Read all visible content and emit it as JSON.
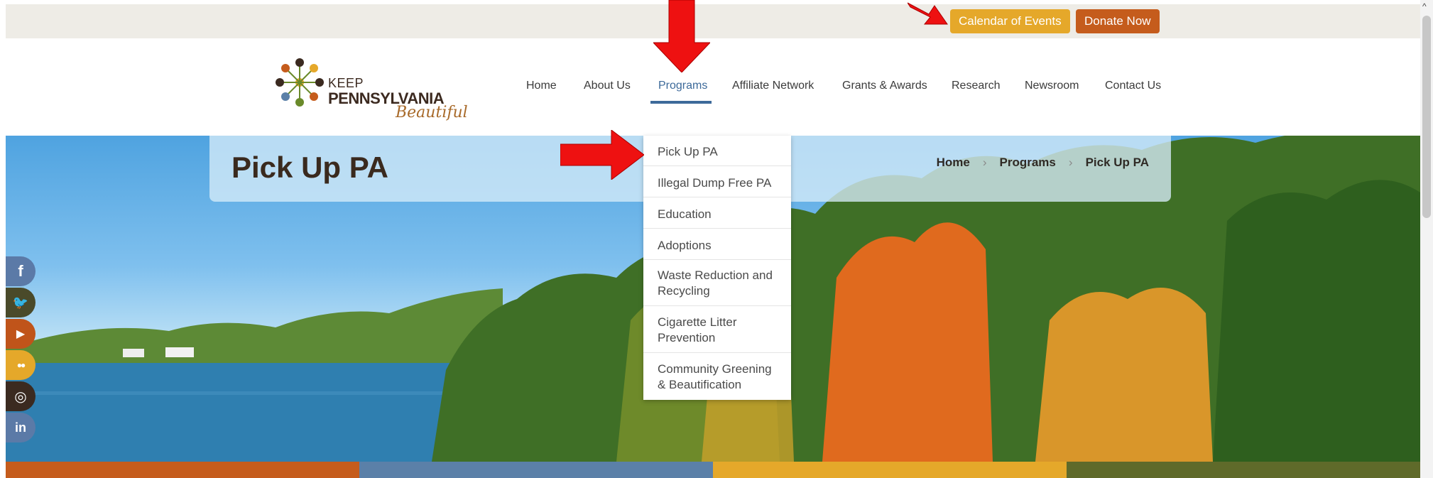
{
  "topbar": {
    "calendar_label": "Calendar of Events",
    "donate_label": "Donate Now"
  },
  "logo": {
    "line1": "KEEP",
    "line2": "PENNSYLVANIA",
    "line3": "Beautiful"
  },
  "nav": {
    "items": [
      "Home",
      "About Us",
      "Programs",
      "Affiliate Network",
      "Grants & Awards",
      "Research",
      "Newsroom",
      "Contact Us"
    ],
    "active": "Programs"
  },
  "page": {
    "title": "Pick Up PA",
    "breadcrumb": [
      "Home",
      "Programs",
      "Pick Up PA"
    ],
    "breadcrumb_separator": "›"
  },
  "dropdown": {
    "items": [
      "Pick Up PA",
      "Illegal Dump Free PA",
      "Education",
      "Adoptions",
      "Waste Reduction and Recycling",
      "Cigarette Litter Prevention",
      "Community Greening & Beautification"
    ]
  },
  "social": {
    "icons": [
      "facebook-icon",
      "twitter-icon",
      "youtube-icon",
      "flickr-icon",
      "instagram-icon",
      "linkedin-icon"
    ],
    "glyphs": [
      "f",
      "🐦",
      "▶",
      "●●",
      "◎",
      "in"
    ],
    "colors": [
      "#5b7aa7",
      "#4a4a2a",
      "#c0541a",
      "#e5a82a",
      "#3b2a20",
      "#5b7aa7"
    ]
  },
  "colors": {
    "accent_blue": "#3d6a9a",
    "calendar_gold": "#e5a82a",
    "donate_orange": "#c55c1c",
    "strip": [
      "#c55c1c",
      "#5b80a8",
      "#e5a82a",
      "#5f6a2a"
    ]
  }
}
